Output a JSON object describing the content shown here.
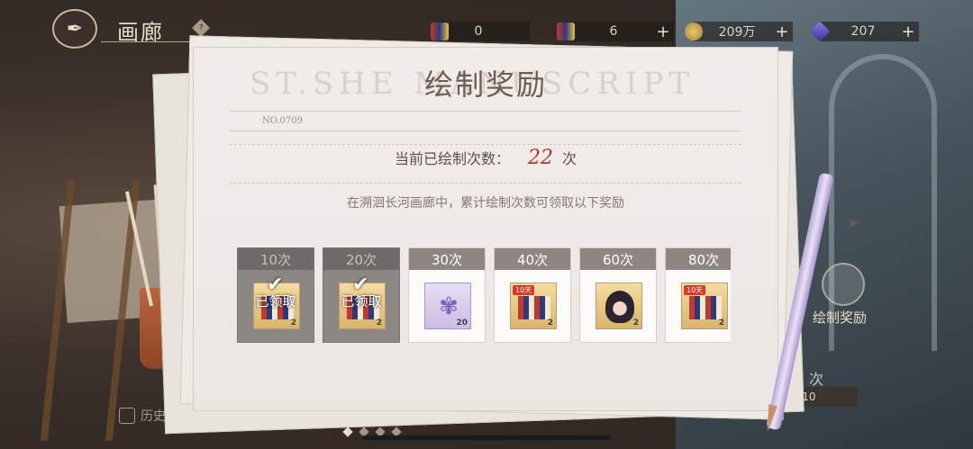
{
  "header": {
    "title": "画廊",
    "help_icon": "?"
  },
  "resources": [
    {
      "icon": "paint-box-icon",
      "value": "0",
      "plus": ""
    },
    {
      "icon": "paint-box-icon",
      "value": "6",
      "plus": "+"
    },
    {
      "icon": "coin-icon",
      "value": "209万",
      "plus": "+"
    },
    {
      "icon": "diamond-icon",
      "value": "207",
      "plus": "+"
    }
  ],
  "panel": {
    "watermark": "ST.SHE   MANUSCRIPT",
    "title": "绘制奖励",
    "doc_no": "NO.0709",
    "count_label": "当前已绘制次数：",
    "count_value": "22",
    "count_unit": "次",
    "description": "在溯洄长河画廊中，累计绘制次数可领取以下奖励"
  },
  "rewards": [
    {
      "tier": "10次",
      "status": "已领取",
      "claimed": true,
      "qty": "2",
      "tag": ""
    },
    {
      "tier": "20次",
      "status": "已领取",
      "claimed": true,
      "qty": "2",
      "tag": ""
    },
    {
      "tier": "30次",
      "status": "",
      "claimed": false,
      "qty": "20",
      "tag": ""
    },
    {
      "tier": "40次",
      "status": "",
      "claimed": false,
      "qty": "2",
      "tag": "10天"
    },
    {
      "tier": "60次",
      "status": "",
      "claimed": false,
      "qty": "2",
      "tag": ""
    },
    {
      "tier": "80次",
      "status": "",
      "claimed": false,
      "qty": "2",
      "tag": "10天"
    }
  ],
  "side": {
    "draw_label": "绘制奖励",
    "times_label": "次",
    "x10_label": "X10"
  },
  "footer": {
    "history_label": "历史记录"
  },
  "colors": {
    "accent_red": "#b8332c",
    "card_header": "#8f8682"
  }
}
